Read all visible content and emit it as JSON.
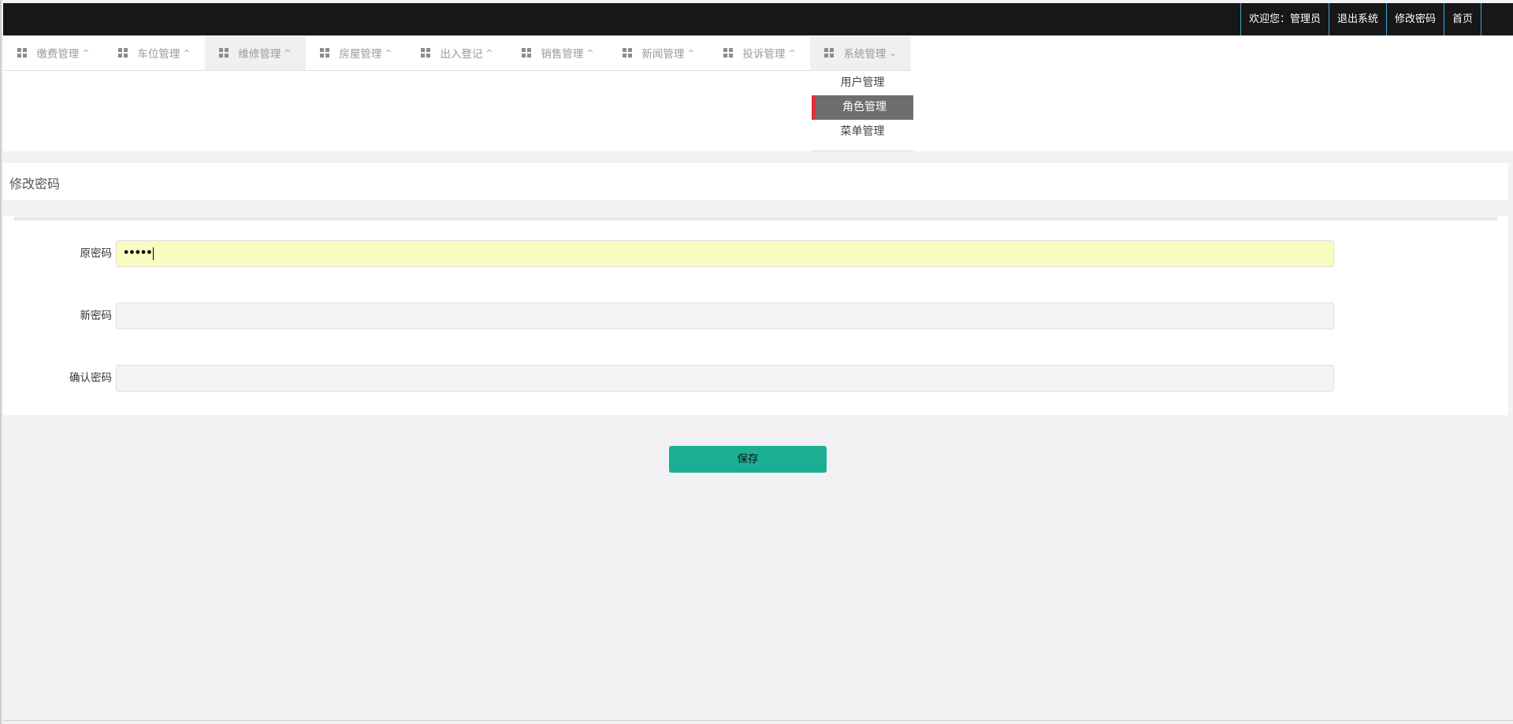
{
  "topbar": {
    "welcome": "欢迎您：管理员",
    "logout": "退出系统",
    "change_password": "修改密码",
    "home": "首页"
  },
  "nav": {
    "items": [
      {
        "label": "缴费管理",
        "caret": "^"
      },
      {
        "label": "车位管理",
        "caret": "^"
      },
      {
        "label": "维修管理",
        "caret": "^"
      },
      {
        "label": "房屋管理",
        "caret": "^"
      },
      {
        "label": "出入登记",
        "caret": "^"
      },
      {
        "label": "销售管理",
        "caret": "^"
      },
      {
        "label": "新闻管理",
        "caret": "^"
      },
      {
        "label": "投诉管理",
        "caret": "^"
      },
      {
        "label": "系统管理",
        "caret": "v"
      }
    ],
    "dropdown": [
      {
        "label": "用户管理"
      },
      {
        "label": "角色管理"
      },
      {
        "label": "菜单管理"
      }
    ],
    "icon": "grid-icon"
  },
  "page": {
    "title": "修改密码"
  },
  "form": {
    "old_password": {
      "label": "原密码",
      "value": "•••••"
    },
    "new_password": {
      "label": "新密码",
      "value": ""
    },
    "confirm_password": {
      "label": "确认密码",
      "value": ""
    },
    "save_label": "保存"
  },
  "colors": {
    "topbar_bg": "#171717",
    "topbar_divider": "#3aa5d8",
    "active_menu_bg": "#6e6e6e",
    "active_menu_marker": "#e0303a",
    "save_button": "#1aaf92",
    "autofill_bg": "#f8fcc0"
  }
}
